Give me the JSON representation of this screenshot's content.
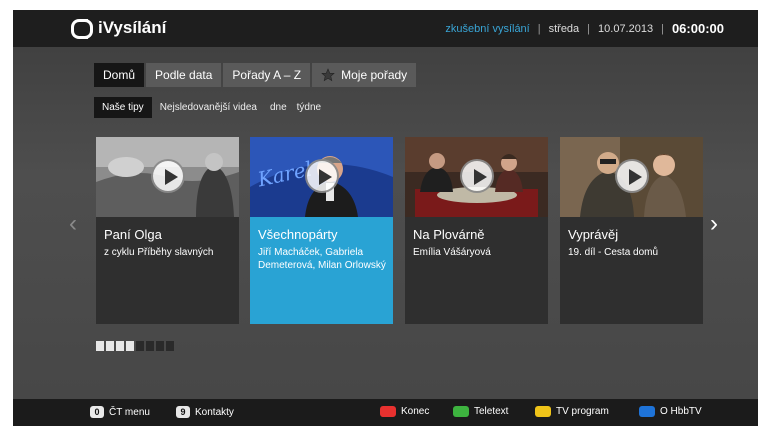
{
  "header": {
    "app_title": "iVysílání",
    "trial": "zkušební vysílání",
    "day": "středa",
    "date": "10.07.2013",
    "time": "06:00:00"
  },
  "tabs": [
    {
      "label": "Domů",
      "active": true
    },
    {
      "label": "Podle data",
      "active": false
    },
    {
      "label": "Pořady A – Z",
      "active": false
    },
    {
      "label": "Moje pořady",
      "active": false,
      "icon": "star-icon"
    }
  ],
  "subtabs": {
    "active": "Naše tipy",
    "most_watched": "Nejsledovanější videa",
    "day": "dne",
    "week": "týdne"
  },
  "cards": [
    {
      "title": "Paní Olga",
      "subtitle": "z cyklu Příběhy slavných",
      "selected": false
    },
    {
      "title": "Všechnopárty",
      "subtitle": "Jiří Macháček, Gabriela Demeterová, Milan Orlowský",
      "selected": true
    },
    {
      "title": "Na Plovárně",
      "subtitle": "Emília Vášáryová",
      "selected": false
    },
    {
      "title": "Vyprávěj",
      "subtitle": "19. díl - Cesta domů",
      "selected": false
    }
  ],
  "pagination": {
    "total": 8,
    "current_count": 4
  },
  "nav": {
    "left": "‹",
    "right": "›"
  },
  "footer": {
    "menu_key": "0",
    "menu_label": "ČT menu",
    "contacts_key": "9",
    "contacts_label": "Kontakty",
    "red_label": "Konec",
    "green_label": "Teletext",
    "yellow_label": "TV program",
    "blue_label": "O HbbTV"
  },
  "colors": {
    "accent": "#29a3d4",
    "red": "#e8312f",
    "green": "#3db33f",
    "yellow": "#f0c419",
    "blue": "#1e73d8"
  }
}
